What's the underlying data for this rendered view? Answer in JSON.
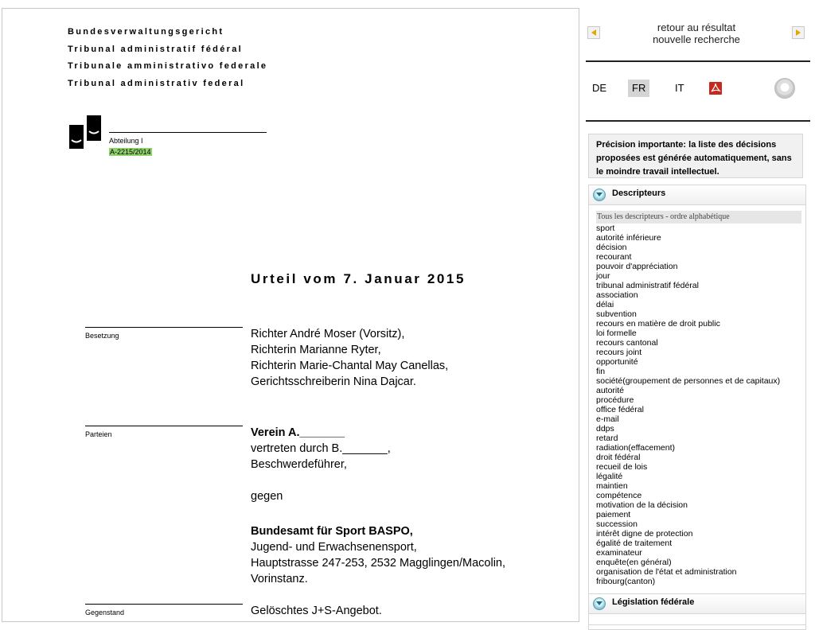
{
  "document": {
    "court_names": [
      "Bundesverwaltungsgericht",
      "Tribunal administratif fédéral",
      "Tribunale amministrativo federale",
      "Tribunal administrativ federal"
    ],
    "division": "Abteilung I",
    "case_number": "A-2215/2014",
    "title": "Urteil vom 7. Januar 2015",
    "besetzung": {
      "label": "Besetzung",
      "lines": [
        "Richter André Moser (Vorsitz),",
        "Richterin Marianne Ryter,",
        "Richterin Marie-Chantal May Canellas,",
        "Gerichtsschreiberin Nina Dajcar."
      ]
    },
    "parteien": {
      "label": "Parteien",
      "party1_name": "Verein A._______",
      "party1_rep": "vertreten durch B._______,",
      "party1_role": "Beschwerdeführer,",
      "versus": "gegen",
      "party2_name": "Bundesamt für Sport BASPO,",
      "party2_lines": [
        "Jugend- und Erwachsenensport,",
        "Hauptstrasse 247-253, 2532 Magglingen/Macolin,",
        "Vorinstanz."
      ]
    },
    "gegenstand": {
      "label": "Gegenstand",
      "text": "Gelöschtes J+S-Angebot."
    }
  },
  "panel": {
    "back_link": "retour au résultat",
    "new_search": "nouvelle recherche",
    "languages": [
      "DE",
      "FR",
      "IT"
    ],
    "active_language": "FR",
    "notice": "Précision importante: la liste des décisions proposées est générée automatiquement, sans le moindre travail intellectuel.",
    "descriptors": {
      "title": "Descripteurs",
      "header": "Tous les descripteurs - ordre alphabétique",
      "items": [
        "sport",
        "autorité inférieure",
        "décision",
        "recourant",
        "pouvoir d'appréciation",
        "jour",
        "tribunal administratif fédéral",
        "association",
        "délai",
        "subvention",
        "recours en matière de droit public",
        "loi formelle",
        "recours cantonal",
        "recours joint",
        "opportunité",
        "fin",
        "société(groupement de personnes et de capitaux)",
        "autorité",
        "procédure",
        "office fédéral",
        "e-mail",
        "ddps",
        "retard",
        "radiation(effacement)",
        "droit fédéral",
        "recueil de lois",
        "légalité",
        "maintien",
        "compétence",
        "motivation de la décision",
        "paiement",
        "succession",
        "intérêt digne de protection",
        "égalité de traitement",
        "examinateur",
        "enquête(en général)",
        "organisation de l'état et administration",
        "fribourg(canton)"
      ]
    },
    "legislation_title": "Législation fédérale"
  }
}
